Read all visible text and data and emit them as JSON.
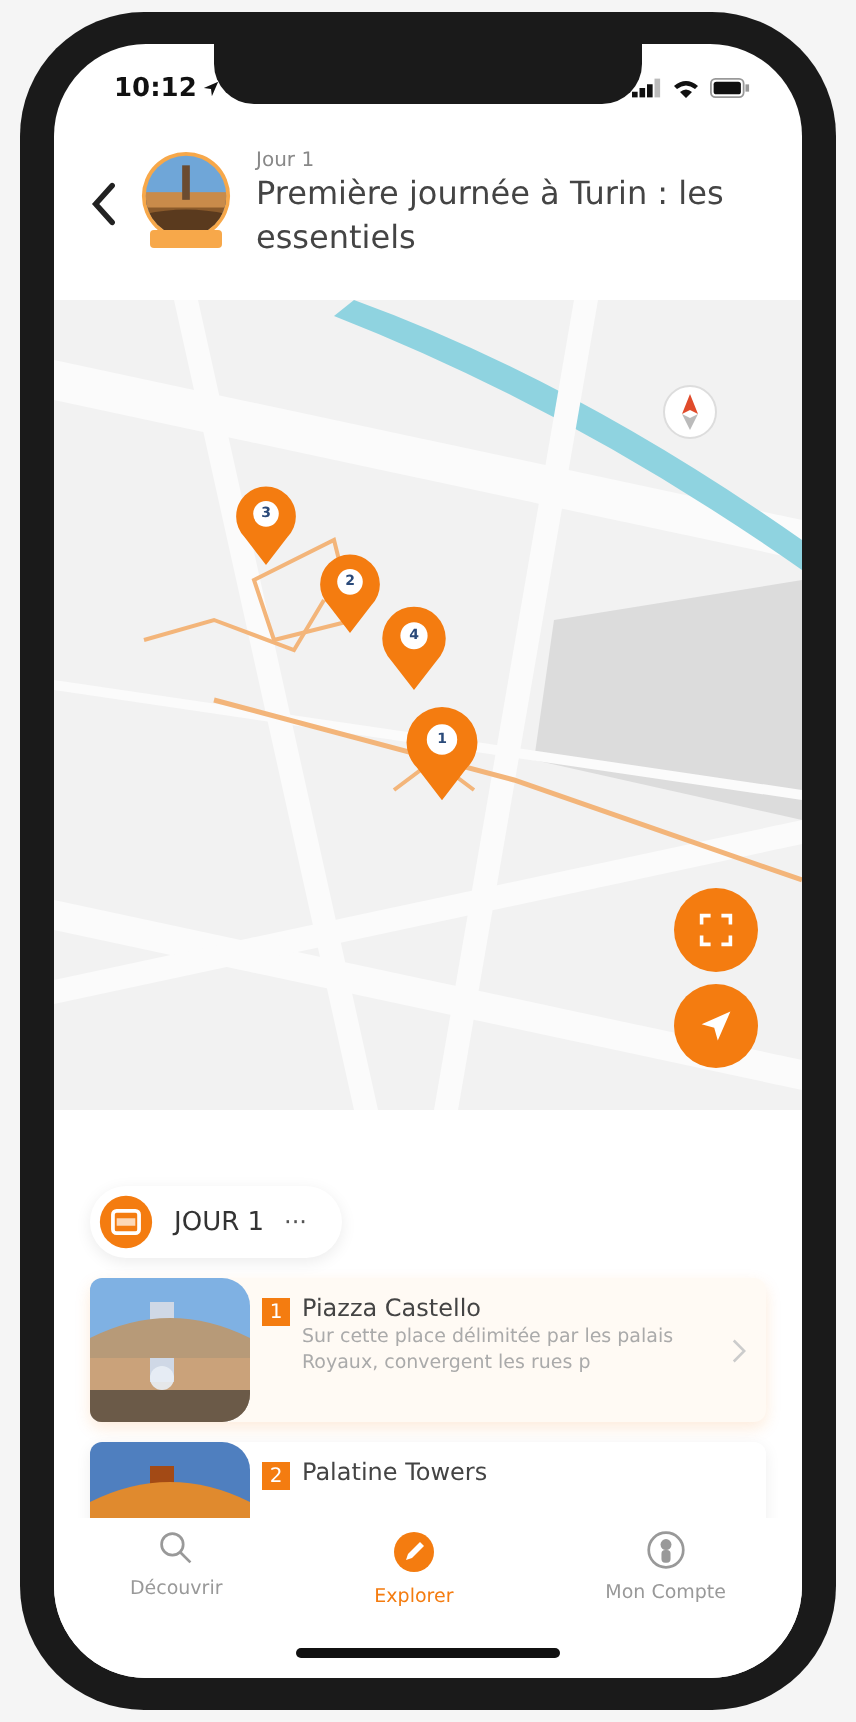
{
  "status_bar": {
    "time": "10:12"
  },
  "header": {
    "subtitle": "Jour 1",
    "title": "Première journée à Turin : les essentiels"
  },
  "map": {
    "pins": [
      {
        "label": "3"
      },
      {
        "label": "2"
      },
      {
        "label": "4"
      },
      {
        "label": "1"
      }
    ]
  },
  "day_chip": {
    "label": "JOUR 1",
    "more": "···"
  },
  "stops": [
    {
      "number": "1",
      "title": "Piazza Castello",
      "description": "Sur cette place délimitée par les palais Royaux, convergent les rues p"
    },
    {
      "number": "2",
      "title": "Palatine Towers"
    }
  ],
  "tab_bar": [
    {
      "label": "Découvrir",
      "kind": "search",
      "selected": false
    },
    {
      "label": "Explorer",
      "kind": "pencil",
      "selected": true
    },
    {
      "label": "Mon Compte",
      "kind": "person",
      "selected": false
    }
  ]
}
